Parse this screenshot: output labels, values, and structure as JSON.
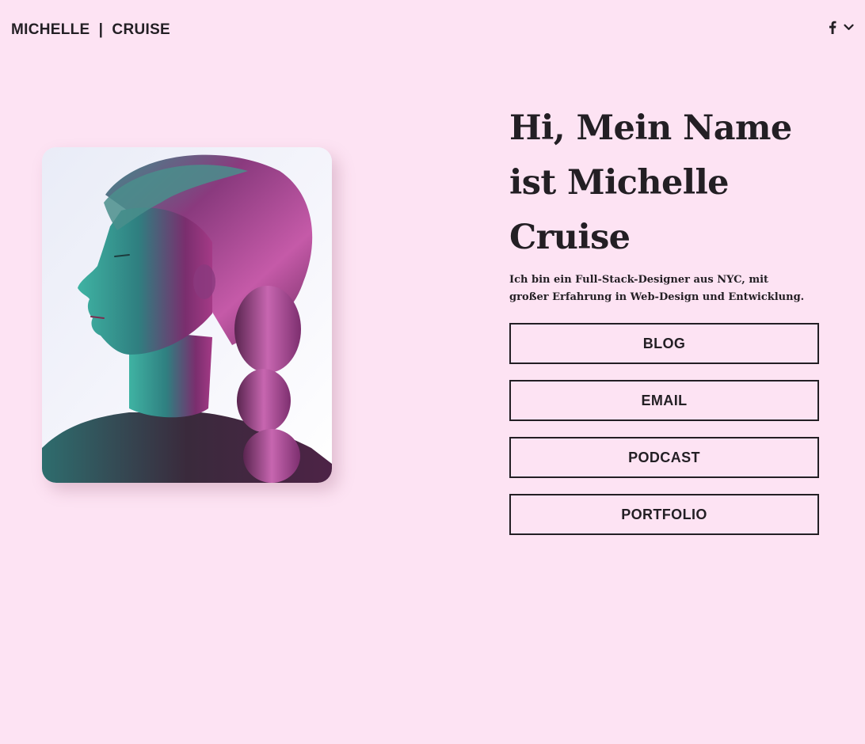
{
  "header": {
    "logo_text": "MICHELLE  |  CRUISE",
    "icons": [
      "facebook-icon",
      "chevron-down-icon"
    ]
  },
  "hero": {
    "title": "Hi, Mein Name ist Michelle Cruise",
    "subtitle": "Ich bin ein Full-Stack-Designer aus NYC, mit großer Erfahrung in Web-Design und Entwicklung."
  },
  "links": [
    {
      "label": "BLOG"
    },
    {
      "label": "EMAIL"
    },
    {
      "label": "PODCAST"
    },
    {
      "label": "PORTFOLIO"
    }
  ],
  "colors": {
    "background": "#fde3f3",
    "text": "#231f24",
    "accent_magenta": "#c04a9a",
    "accent_teal": "#3aa89a"
  }
}
